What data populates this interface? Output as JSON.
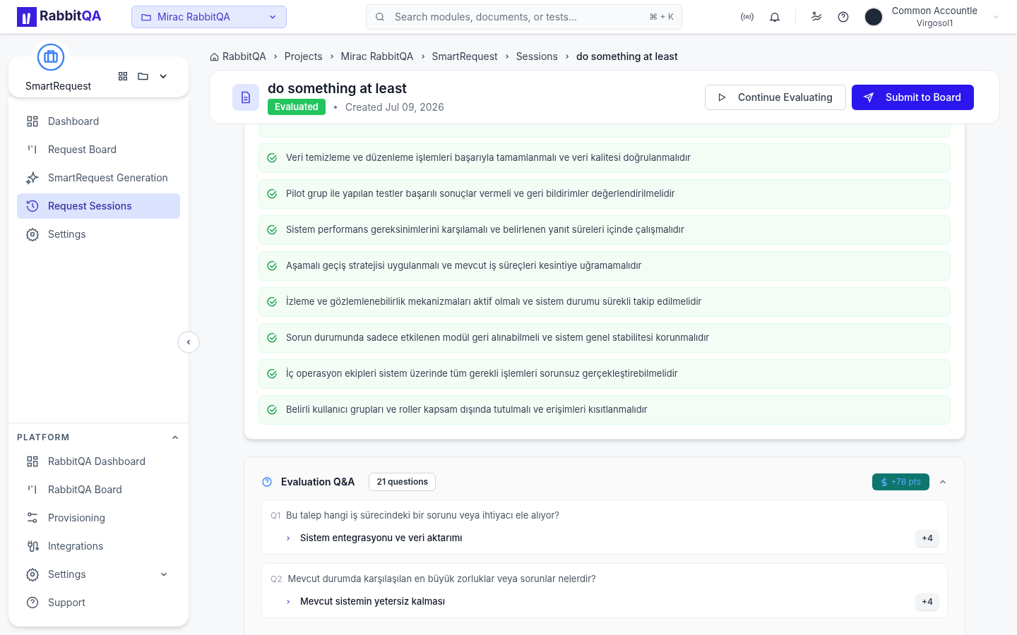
{
  "brand": {
    "name": "Rabbit",
    "accent": "QA"
  },
  "project_selector": {
    "label": "Mirac RabbitQA"
  },
  "search": {
    "placeholder": "Search modules, documents, or tests...",
    "shortcut": "⌘ + K"
  },
  "user": {
    "name": "Common Accountle",
    "org": "Virgosol1"
  },
  "module": {
    "name": "SmartRequest"
  },
  "nav": [
    {
      "label": "Dashboard",
      "selected": false
    },
    {
      "label": "Request Board",
      "selected": false
    },
    {
      "label": "SmartRequest Generation",
      "selected": false
    },
    {
      "label": "Request Sessions",
      "selected": true
    },
    {
      "label": "Settings",
      "selected": false
    }
  ],
  "platform": {
    "title": "PLATFORM",
    "expanded": true,
    "items": [
      {
        "label": "RabbitQA Dashboard",
        "has_submenu": false
      },
      {
        "label": "RabbitQA Board",
        "has_submenu": false
      },
      {
        "label": "Provisioning",
        "has_submenu": false
      },
      {
        "label": "Integrations",
        "has_submenu": false
      },
      {
        "label": "Settings",
        "has_submenu": true
      },
      {
        "label": "Support",
        "has_submenu": false
      }
    ]
  },
  "breadcrumb": [
    "RabbitQA",
    "Projects",
    "Mirac RabbitQA",
    "SmartRequest",
    "Sessions",
    "do something at least"
  ],
  "session": {
    "title": "do something at least",
    "status": "Evaluated",
    "created": "Created Jul 09, 2026"
  },
  "actions": [
    {
      "label": "Continue Evaluating",
      "kind": "secondary"
    },
    {
      "label": "Submit to Board",
      "kind": "primary"
    }
  ],
  "criteria": [
    {
      "text": "Veri temizleme ve düzenleme işlemleri başarıyla tamamlanmalı ve veri kalitesi doğrulanmalıdır",
      "met": true
    },
    {
      "text": "Pilot grup ile yapılan testler başarılı sonuçlar vermeli ve geri bildirimler değerlendirilmelidir",
      "met": true
    },
    {
      "text": "Sistem performans gereksinimlerini karşılamalı ve belirlenen yanıt süreleri içinde çalışmalıdır",
      "met": true
    },
    {
      "text": "Aşamalı geçiş stratejisi uygulanmalı ve mevcut iş süreçleri kesintiye uğramamalıdır",
      "met": true
    },
    {
      "text": "İzleme ve gözlemlenebilirlik mekanizmaları aktif olmalı ve sistem durumu sürekli takip edilmelidir",
      "met": true
    },
    {
      "text": "Sorun durumunda sadece etkilenen modül geri alınabilmeli ve sistem genel stabilitesi korunmalıdır",
      "met": true
    },
    {
      "text": "İç operasyon ekipleri sistem üzerinde tüm gerekli işlemleri sorunsuz gerçekleştirebilmelidir",
      "met": true
    },
    {
      "text": "Belirli kullanıcı grupları ve roller kapsam dışında tutulmalı ve erişimleri kısıtlanmalıdır",
      "met": true
    }
  ],
  "qa": {
    "title": "Evaluation Q&A",
    "count": "21 questions",
    "points": "+78 pts",
    "expanded": true,
    "questions": [
      {
        "number": "Q1",
        "question": "Bu talep hangi iş sürecindeki bir sorunu veya ihtiyacı ele alıyor?",
        "answer": "Sistem entegrasyonu ve veri aktarımı",
        "score": "+4"
      },
      {
        "number": "Q2",
        "question": "Mevcut durumda karşılaşılan en büyük zorluklar veya sorunlar nelerdir?",
        "answer": "Mevcut sistemin yetersiz kalması",
        "score": "+4"
      }
    ]
  }
}
